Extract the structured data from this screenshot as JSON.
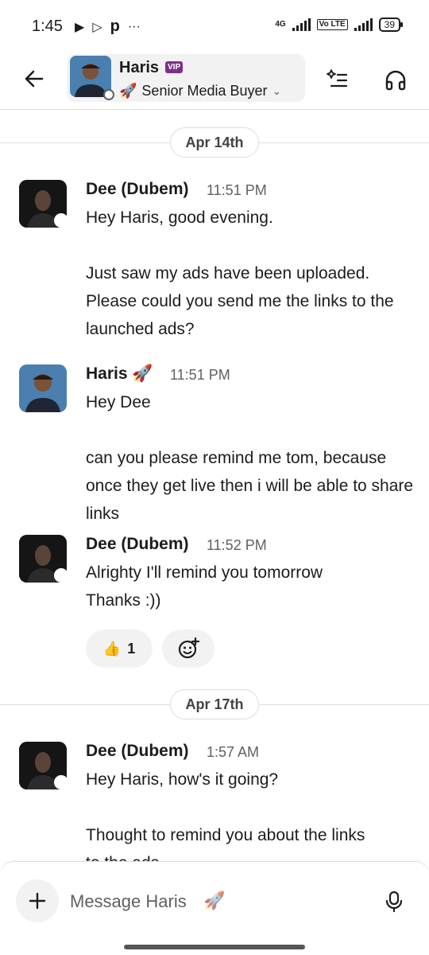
{
  "status_bar": {
    "time": "1:45",
    "app_icons": [
      "play-icon",
      "play-outline-icon",
      "p-app-icon",
      "more-dots-icon"
    ],
    "network_4g": "4G",
    "volte": "Vo LTE",
    "battery": "39"
  },
  "header": {
    "name": "Haris",
    "vip_label": "VIP",
    "status_emoji": "🚀",
    "status_text": "Senior Media Buyer",
    "chevron": "⌄"
  },
  "dates": {
    "d1": "Apr 14th",
    "d2": "Apr 17th"
  },
  "messages": [
    {
      "sender": "Dee (Dubem)",
      "time": "11:51 PM",
      "lines": [
        "Hey Haris, good evening.",
        "",
        "Just saw my ads have been uploaded. Please could you send me the links to the launched ads?"
      ]
    },
    {
      "sender": "Haris",
      "sender_emoji": "🚀",
      "time": "11:51 PM",
      "lines": [
        "Hey Dee",
        "",
        "can you please remind me tom, because once they get live then i will be able to share links"
      ]
    },
    {
      "sender": "Dee (Dubem)",
      "time": "11:52 PM",
      "lines": [
        "Alrighty I'll remind you tomorrow",
        "Thanks :))"
      ],
      "reaction": {
        "emoji": "👍",
        "count": "1"
      }
    },
    {
      "sender": "Dee (Dubem)",
      "time": "1:57 AM",
      "lines": [
        "Hey Haris, how's it going?",
        "",
        "Thought to remind you about the links",
        "to the ads"
      ]
    }
  ],
  "composer": {
    "placeholder": "Message Haris",
    "placeholder_emoji": "🚀"
  },
  "colors": {
    "vip": "#7c3085",
    "divider": "#dddddd",
    "muted_text": "#616061",
    "chip_bg": "#f2f2f2"
  }
}
